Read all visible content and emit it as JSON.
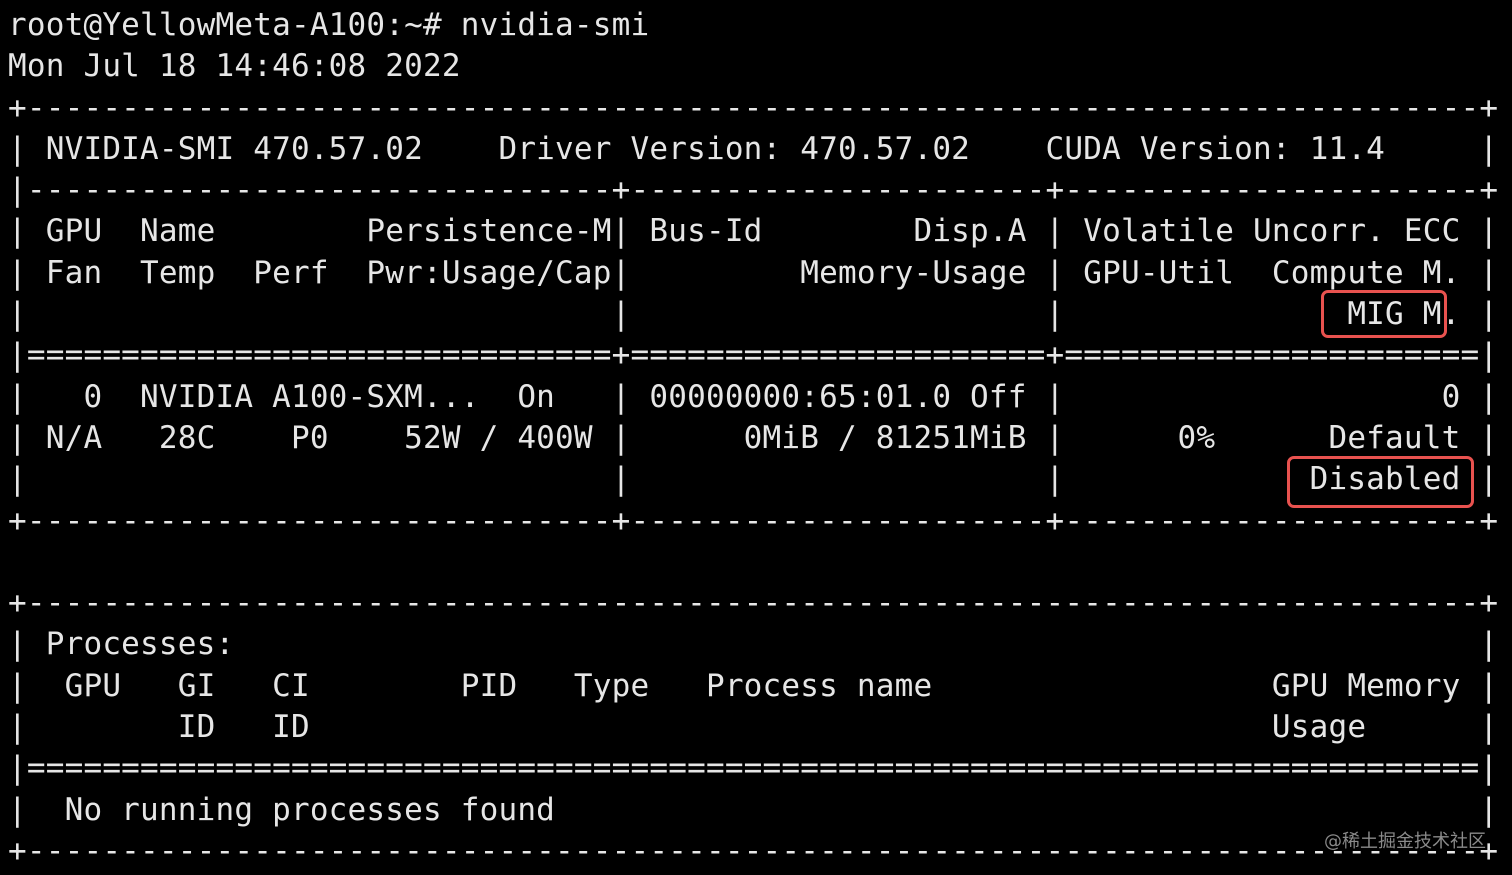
{
  "terminal": {
    "lines": [
      "root@YellowMeta-A100:~# nvidia-smi",
      "Mon Jul 18 14:46:08 2022",
      "+-----------------------------------------------------------------------------+",
      "| NVIDIA-SMI 470.57.02    Driver Version: 470.57.02    CUDA Version: 11.4     |",
      "|-------------------------------+----------------------+----------------------+",
      "| GPU  Name        Persistence-M| Bus-Id        Disp.A | Volatile Uncorr. ECC |",
      "| Fan  Temp  Perf  Pwr:Usage/Cap|         Memory-Usage | GPU-Util  Compute M. |",
      "|                               |                      |               MIG M. |",
      "|===============================+======================+======================|",
      "|   0  NVIDIA A100-SXM...  On   | 00000000:65:01.0 Off |                    0 |",
      "| N/A   28C    P0    52W / 400W |      0MiB / 81251MiB |      0%      Default |",
      "|                               |                      |             Disabled |",
      "+-------------------------------+----------------------+----------------------+",
      "",
      "+-----------------------------------------------------------------------------+",
      "| Processes:                                                                  |",
      "|  GPU   GI   CI        PID   Type   Process name                  GPU Memory |",
      "|        ID   ID                                                   Usage      |",
      "|=============================================================================|",
      "|  No running processes found                                                 |",
      "+-----------------------------------------------------------------------------+"
    ]
  },
  "highlight_color": "#e8524f",
  "watermark": "@稀土掘金技术社区"
}
